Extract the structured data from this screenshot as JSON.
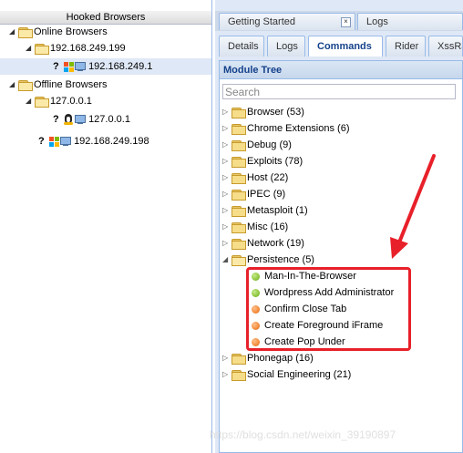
{
  "left_panel": {
    "title": "Hooked Browsers",
    "groups": [
      {
        "label": "Online Browsers",
        "hosts": [
          {
            "label": "192.168.249.199",
            "browsers": [
              {
                "label": "192.168.249.1",
                "os": "windows",
                "selected": true
              }
            ]
          }
        ]
      },
      {
        "label": "Offline Browsers",
        "hosts": [
          {
            "label": "127.0.0.1",
            "browsers": [
              {
                "label": "127.0.0.1",
                "os": "linux"
              }
            ]
          }
        ],
        "browsers": [
          {
            "label": "192.168.249.198",
            "os": "windows"
          }
        ]
      }
    ],
    "question_mark": "?"
  },
  "top_tabs": [
    {
      "label": "Getting Started",
      "close": "×"
    },
    {
      "label": "Logs"
    }
  ],
  "sub_tabs": [
    {
      "label": "Details"
    },
    {
      "label": "Logs"
    },
    {
      "label": "Commands",
      "active": true
    },
    {
      "label": "Rider"
    },
    {
      "label": "XssRa"
    }
  ],
  "module_tree": {
    "title": "Module Tree",
    "search_placeholder": "Search",
    "categories": [
      {
        "label": "Browser (53)"
      },
      {
        "label": "Chrome Extensions (6)"
      },
      {
        "label": "Debug (9)"
      },
      {
        "label": "Exploits (78)"
      },
      {
        "label": "Host (22)"
      },
      {
        "label": "IPEC (9)"
      },
      {
        "label": "Metasploit (1)"
      },
      {
        "label": "Misc (16)"
      },
      {
        "label": "Network (19)"
      },
      {
        "label": "Persistence (5)",
        "expanded": true,
        "modules": [
          {
            "label": "Man-In-The-Browser",
            "status": "green"
          },
          {
            "label": "Wordpress Add Administrator",
            "status": "green"
          },
          {
            "label": "Confirm Close Tab",
            "status": "orange"
          },
          {
            "label": "Create Foreground iFrame",
            "status": "orange"
          },
          {
            "label": "Create Pop Under",
            "status": "orange"
          }
        ]
      },
      {
        "label": "Phonegap (16)"
      },
      {
        "label": "Social Engineering (21)"
      }
    ]
  },
  "watermark": "https://blog.csdn.net/weixin_39190897",
  "colors": {
    "annotation": "#e8202a",
    "green_status": "#8dc63f",
    "orange_status": "#f28b3b",
    "selection": "#dfe8f6"
  }
}
